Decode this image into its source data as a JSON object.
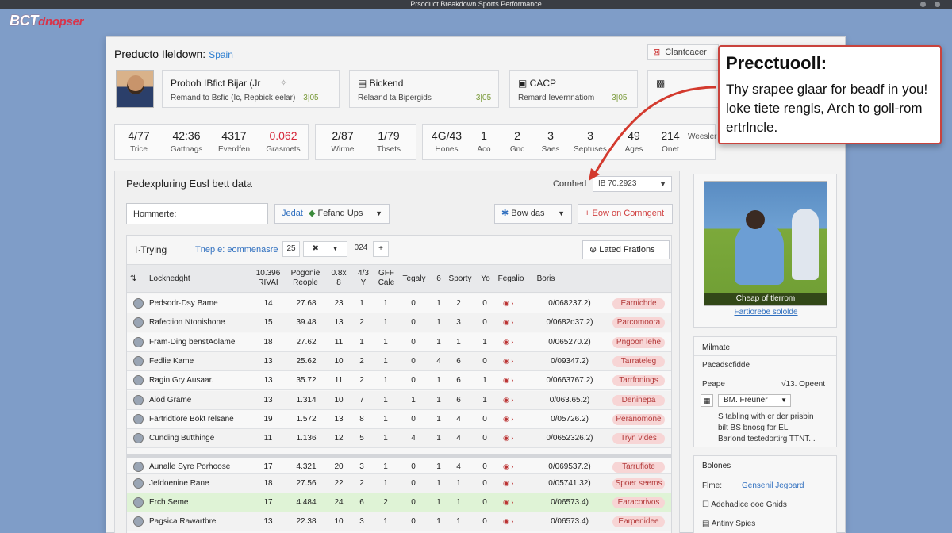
{
  "window": {
    "title": "Prsoduct Breakdown Sports Performance"
  },
  "brand": {
    "name_bold": "BCT",
    "name_rest": "dnopser"
  },
  "header": {
    "title": "Preducto Ileldown:",
    "subtitle": "Spain",
    "control_button": "Clantcacer",
    "control_icon": "close-icon"
  },
  "cards": [
    {
      "title": "Proboh IBfict Bijar (Jr",
      "subtitle": "Remand to Bsfic (Ic, Repbick eelar)",
      "count": "3|05"
    },
    {
      "title": "Bickend",
      "subtitle": "Relaand ta Bipergids",
      "count": "3|05"
    },
    {
      "title": "CACP",
      "subtitle": "Remard Ievernnatiom",
      "count": "3|05"
    },
    {
      "title": "",
      "subtitle": "",
      "count": ""
    }
  ],
  "stats_group1": [
    {
      "value": "4/77",
      "label": "Trice"
    },
    {
      "value": "42:36",
      "label": "Gattnags"
    },
    {
      "value": "4317",
      "label": "Everdfen"
    },
    {
      "value": "0.062",
      "label": "Grasmets",
      "red": true
    }
  ],
  "stats_group2": [
    {
      "value": "2/87",
      "label": "Wirme"
    },
    {
      "value": "1/79",
      "label": "Tbsets"
    }
  ],
  "stats_group3": [
    {
      "value": "4G/43",
      "label": "Hones"
    },
    {
      "value": "1",
      "label": "Aco"
    },
    {
      "value": "2",
      "label": "Gnc"
    },
    {
      "value": "3",
      "label": "Saes"
    },
    {
      "value": "3",
      "label": "Septuses"
    },
    {
      "value": "49",
      "label": "Ages"
    },
    {
      "value": "214",
      "label": "Onet"
    },
    {
      "value": "",
      "label": "Weesler"
    }
  ],
  "section": {
    "title": "Pedexpluring Eusl bett data",
    "select_label": "Cornhed",
    "select_value": "IB 70.2923",
    "input_value": "Hommerte:",
    "filter_btn_prefix": "Jedat",
    "filter_btn_label": "Fefand Ups",
    "sort_btn_label": "Bow das",
    "export_btn_label": "Eow on Comngent"
  },
  "table": {
    "toolbar_title": "I·Trying",
    "toolbar_link": "Tnep e: eommenasre",
    "pager_left": "25",
    "pager_mid": "✖",
    "pager_right": "024",
    "pager_plus": "+",
    "latest_btn": "Lated Frations",
    "headers": [
      "Locknedght",
      "10.396 RIVAI",
      "Pogonie Reople",
      "0.8x 8",
      "4/3 Y",
      "GFF Cale",
      "Tegaly",
      "6",
      "Sporty",
      "Yo",
      "Fegalio",
      "Boris"
    ],
    "rows": [
      {
        "name": "Pedsodr·Dsy Bame",
        "c1": "14",
        "c2": "27.68",
        "c3": "23",
        "c4": "1",
        "c5": "1",
        "c6": "0",
        "c7": "1",
        "c8": "2",
        "c9": "0",
        "score": "0/068237.2)",
        "tag": "Earnichde"
      },
      {
        "name": "Rafection Ntonishone",
        "c1": "15",
        "c2": "39.48",
        "c3": "13",
        "c4": "2",
        "c5": "1",
        "c6": "0",
        "c7": "1",
        "c8": "3",
        "c9": "0",
        "score": "0/0682d37.2)",
        "tag": "Parcomoora"
      },
      {
        "name": "Fram·Ding benstAolame",
        "c1": "18",
        "c2": "27.62",
        "c3": "11",
        "c4": "1",
        "c5": "1",
        "c6": "0",
        "c7": "1",
        "c8": "1",
        "c9": "1",
        "score": "0/065270.2)",
        "tag": "Pngoon lehe"
      },
      {
        "name": "Fedlie Kame",
        "c1": "13",
        "c2": "25.62",
        "c3": "10",
        "c4": "2",
        "c5": "1",
        "c6": "0",
        "c7": "4",
        "c8": "6",
        "c9": "0",
        "score": "0/09347.2)",
        "tag": "Tarrateleg"
      },
      {
        "name": "Ragin Gry Ausaar.",
        "c1": "13",
        "c2": "35.72",
        "c3": "11",
        "c4": "2",
        "c5": "1",
        "c6": "0",
        "c7": "1",
        "c8": "6",
        "c9": "1",
        "score": "0/0663767.2)",
        "tag": "Tarrfonings"
      },
      {
        "name": "Aiod Grame",
        "c1": "13",
        "c2": "1.314",
        "c3": "10",
        "c4": "7",
        "c5": "1",
        "c6": "1",
        "c7": "1",
        "c8": "6",
        "c9": "1",
        "score": "0/063.65.2)",
        "tag": "Deninepa"
      },
      {
        "name": "Fartridtiore Bokt relsane",
        "c1": "19",
        "c2": "1.572",
        "c3": "13",
        "c4": "8",
        "c5": "1",
        "c6": "0",
        "c7": "1",
        "c8": "4",
        "c9": "0",
        "score": "0/05726.2)",
        "tag": "Peranomone"
      },
      {
        "name": "Cunding Butthinge",
        "c1": "11",
        "c2": "1.136",
        "c3": "12",
        "c4": "5",
        "c5": "1",
        "c6": "4",
        "c7": "1",
        "c8": "4",
        "c9": "0",
        "score": "0/0652326.2)",
        "tag": "Tryn vides"
      },
      {
        "name": "Aunalle Syre Porhoose",
        "c1": "17",
        "c2": "4.321",
        "c3": "20",
        "c4": "3",
        "c5": "1",
        "c6": "0",
        "c7": "1",
        "c8": "4",
        "c9": "0",
        "score": "0/069537.2)",
        "tag": "Tarrufiote"
      },
      {
        "name": "Jefdoenine Rane",
        "c1": "18",
        "c2": "27.56",
        "c3": "22",
        "c4": "2",
        "c5": "1",
        "c6": "0",
        "c7": "1",
        "c8": "1",
        "c9": "0",
        "score": "0/05741.32)",
        "tag": "Spoer seems"
      },
      {
        "name": "Erch Seme",
        "c1": "17",
        "c2": "4.484",
        "c3": "24",
        "c4": "6",
        "c5": "2",
        "c6": "0",
        "c7": "1",
        "c8": "1",
        "c9": "0",
        "score": "0/06573.4)",
        "tag": "Earacorivos"
      },
      {
        "name": "Pagsica Rawartbre",
        "c1": "13",
        "c2": "22.38",
        "c3": "10",
        "c4": "3",
        "c5": "1",
        "c6": "0",
        "c7": "1",
        "c8": "1",
        "c9": "0",
        "score": "0/06573.4)",
        "tag": "Earpenidee"
      }
    ]
  },
  "right": {
    "photo_caption": "Cheap of tlerrom",
    "photo_link": "Fartiorebe sololde",
    "box2_title": "Milmate",
    "box2_line1": "Pacadscfidde",
    "box2_line2_left": "Peape",
    "box2_line2_right": "√13. Opeent",
    "box2_btn": "BM. Freuner",
    "box2_text1": "S tabling with er der prisbin",
    "box2_text2": "bilt BS bnosg for EL",
    "box2_text3": "Barlond testedortirg TTNT...",
    "box3_title": "Bolones",
    "box3_line1_left": "Flme:",
    "box3_line1_right": "Gensenil Jegoard",
    "box3_line2": "Adehadice ooe Gnids",
    "box3_line3": "Antiny Spies"
  },
  "callout": {
    "heading": "Precctuooll:",
    "body": "Thy srapee glaar for beadf in you! loke tiete rengls, Arch to goll-rom ertrlncle."
  },
  "colors": {
    "accent_red": "#c9433d",
    "link_blue": "#2f6fbf",
    "highlight_row": "#dff3d6"
  }
}
